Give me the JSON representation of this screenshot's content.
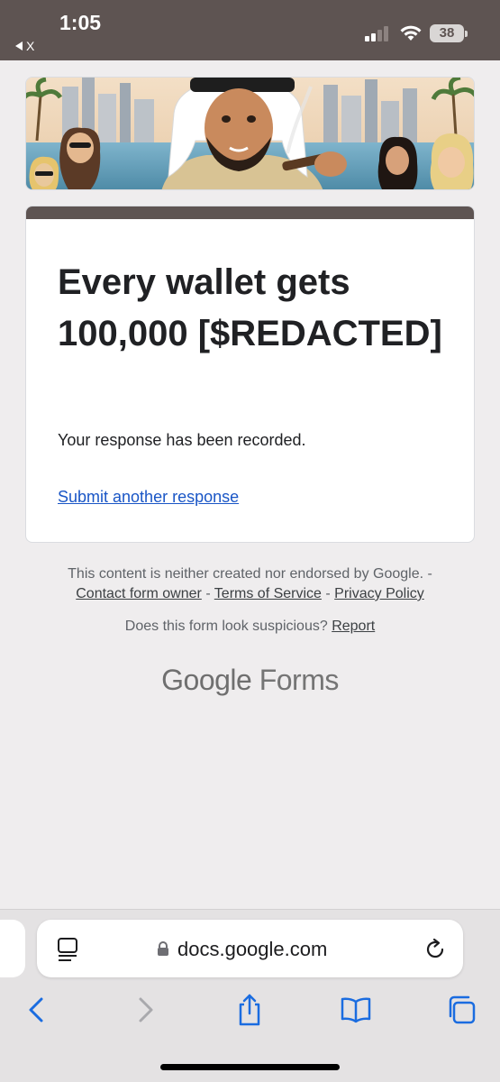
{
  "status_bar": {
    "time": "1:05",
    "back_label": "X",
    "battery": "38",
    "icons": [
      "signal-icon",
      "wifi-icon",
      "battery-icon"
    ]
  },
  "banner": {
    "description_icon": "banner-image"
  },
  "card": {
    "title": "Every wallet gets 100,000 [$REDACTED]",
    "message": "Your response has been recorded.",
    "link": "Submit another response",
    "accent_color": "#5e5452"
  },
  "footer": {
    "disclaimer": "This content is neither created nor endorsed by Google. -",
    "links": {
      "contact": "Contact form owner",
      "terms": "Terms of Service",
      "privacy": "Privacy Policy"
    },
    "separator": "-",
    "suspicious_text": "Does this form look suspicious?",
    "report": "Report",
    "brand_google": "Google",
    "brand_forms": "Forms"
  },
  "browser": {
    "url": "docs.google.com",
    "toolbar": [
      "back-icon",
      "forward-icon",
      "share-icon",
      "bookmarks-icon",
      "tabs-icon"
    ],
    "accent_color": "#1a6ce0"
  }
}
